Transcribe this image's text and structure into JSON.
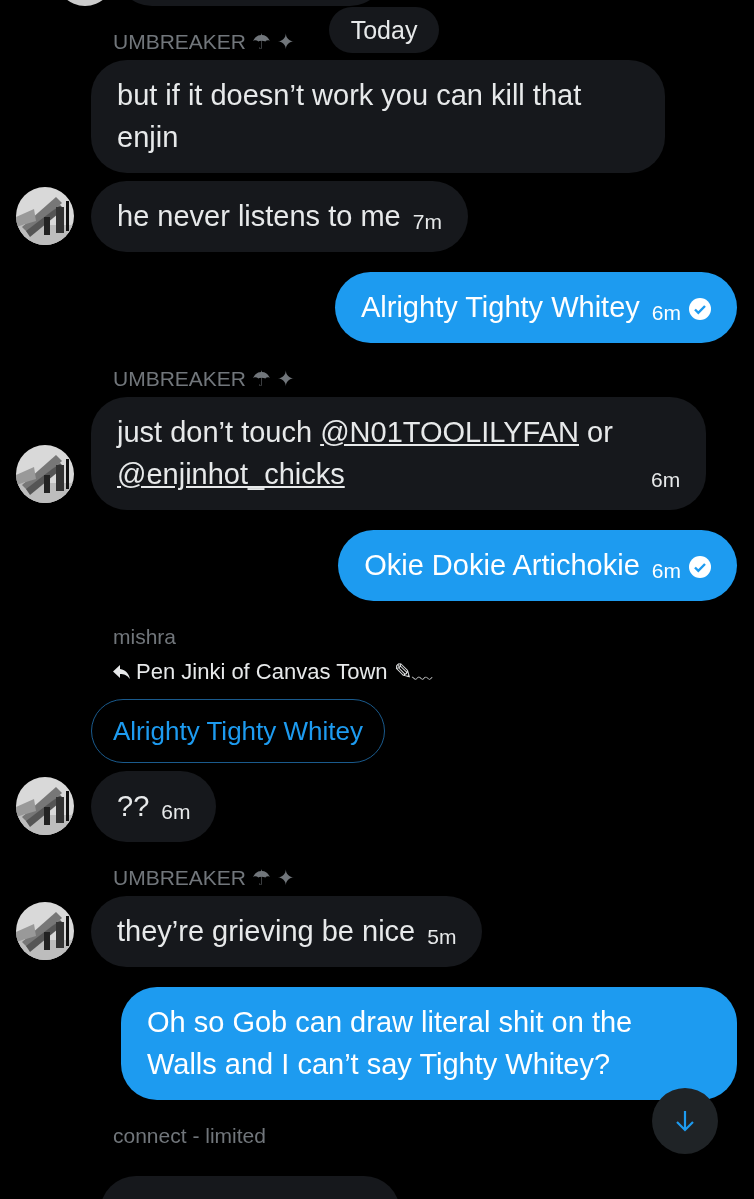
{
  "messages": [
    {
      "kind": "cut_off",
      "avatar": true
    },
    {
      "kind": "sender",
      "name": "UMBREAKER ☂ ✦",
      "date_pill": "Today"
    },
    {
      "kind": "incoming",
      "avatar": false,
      "parts": [
        {
          "text": "but if it doesn’t work you can kill that enjin",
          "link": false
        }
      ]
    },
    {
      "kind": "incoming",
      "avatar": true,
      "parts": [
        {
          "text": "he never listens to me",
          "link": false
        }
      ],
      "time": "7m"
    },
    {
      "kind": "outgoing",
      "text": "Alrighty Tighty Whitey",
      "time": "6m",
      "read": true
    },
    {
      "kind": "sender",
      "name": "UMBREAKER ☂ ✦"
    },
    {
      "kind": "incoming",
      "avatar": true,
      "parts": [
        {
          "text": "just don’t touch ",
          "link": false
        },
        {
          "text": "@N01TOOLILYFAN",
          "link": true
        },
        {
          "text": " or ",
          "link": false
        },
        {
          "text": "@enjinhot_chicks",
          "link": true
        }
      ],
      "time": "6m"
    },
    {
      "kind": "outgoing",
      "text": "Okie Dokie Artichokie",
      "time": "6m",
      "read": true
    },
    {
      "kind": "reply",
      "sender": "mishra",
      "replying_to": "Pen Jinki of Canvas Town ✎﹏",
      "quoted": "Alrighty Tighty Whitey"
    },
    {
      "kind": "incoming",
      "avatar": true,
      "parts": [
        {
          "text": "??",
          "link": false
        }
      ],
      "time": "6m"
    },
    {
      "kind": "sender",
      "name": "UMBREAKER ☂ ✦"
    },
    {
      "kind": "incoming",
      "avatar": true,
      "parts": [
        {
          "text": "they’re grieving be nice",
          "link": false
        }
      ],
      "time": "5m"
    },
    {
      "kind": "outgoing",
      "text": "Oh so Gob can draw literal shit on the Walls and I can’t say Tighty Whitey?"
    },
    {
      "kind": "sender",
      "name": "connect - limited"
    },
    {
      "kind": "cut_off",
      "avatar": false
    }
  ],
  "scroll_button": true
}
